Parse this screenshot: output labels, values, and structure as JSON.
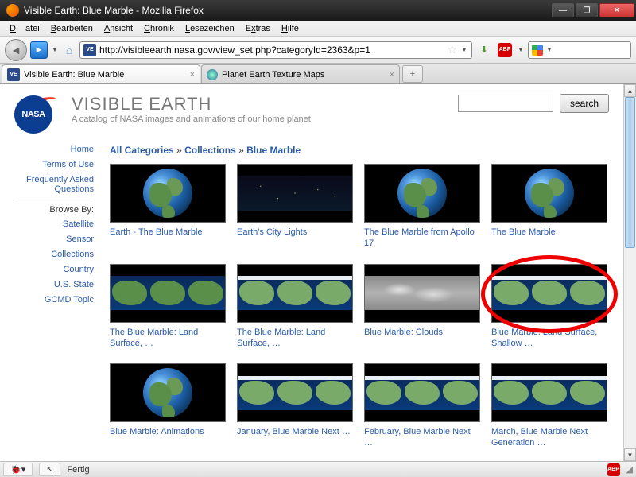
{
  "window": {
    "title": "Visible Earth: Blue Marble - Mozilla Firefox"
  },
  "menu": {
    "file": "Datei",
    "edit": "Bearbeiten",
    "view": "Ansicht",
    "history": "Chronik",
    "bookmarks": "Lesezeichen",
    "extras": "Extras",
    "help": "Hilfe"
  },
  "url": "http://visibleearth.nasa.gov/view_set.php?categoryId=2363&p=1",
  "tabs": [
    {
      "favicon": "VE",
      "label": "Visible Earth: Blue Marble"
    },
    {
      "favicon": "planet",
      "label": "Planet Earth Texture Maps"
    }
  ],
  "site": {
    "title": "VISIBLE EARTH",
    "subtitle": "A catalog of NASA images and animations of our home planet",
    "logo": "NASA"
  },
  "search": {
    "button": "search",
    "placeholder": ""
  },
  "breadcrumb": {
    "a": "All Categories",
    "sep": "»",
    "b": "Collections",
    "c": "Blue Marble"
  },
  "sidebar": {
    "home": "Home",
    "terms": "Terms of Use",
    "faq": "Frequently Asked Questions",
    "browse_label": "Browse By:",
    "satellite": "Satellite",
    "sensor": "Sensor",
    "collections": "Collections",
    "country": "Country",
    "usstate": "U.S. State",
    "gcmd": "GCMD Topic"
  },
  "thumbs": [
    {
      "label": "Earth - The Blue Marble",
      "type": "globe"
    },
    {
      "label": "Earth's City Lights",
      "type": "nightmap"
    },
    {
      "label": "The Blue Marble from Apollo 17",
      "type": "globe"
    },
    {
      "label": "The Blue Marble",
      "type": "globe"
    },
    {
      "label": "The Blue Marble: Land Surface, …",
      "type": "flatmap"
    },
    {
      "label": "The Blue Marble: Land Surface, …",
      "type": "flatmap-ice"
    },
    {
      "label": "Blue Marble: Clouds",
      "type": "cloudmap"
    },
    {
      "label": "Blue Marble: Land Surface, Shallow …",
      "type": "flatmap-ice",
      "highlight": true
    },
    {
      "label": "Blue Marble: Animations",
      "type": "globe"
    },
    {
      "label": "January, Blue Marble Next …",
      "type": "flatmap-ice"
    },
    {
      "label": "February, Blue Marble Next …",
      "type": "flatmap-ice"
    },
    {
      "label": "March, Blue Marble Next Generation …",
      "type": "flatmap-ice"
    }
  ],
  "statusbar": {
    "text": "Fertig"
  }
}
